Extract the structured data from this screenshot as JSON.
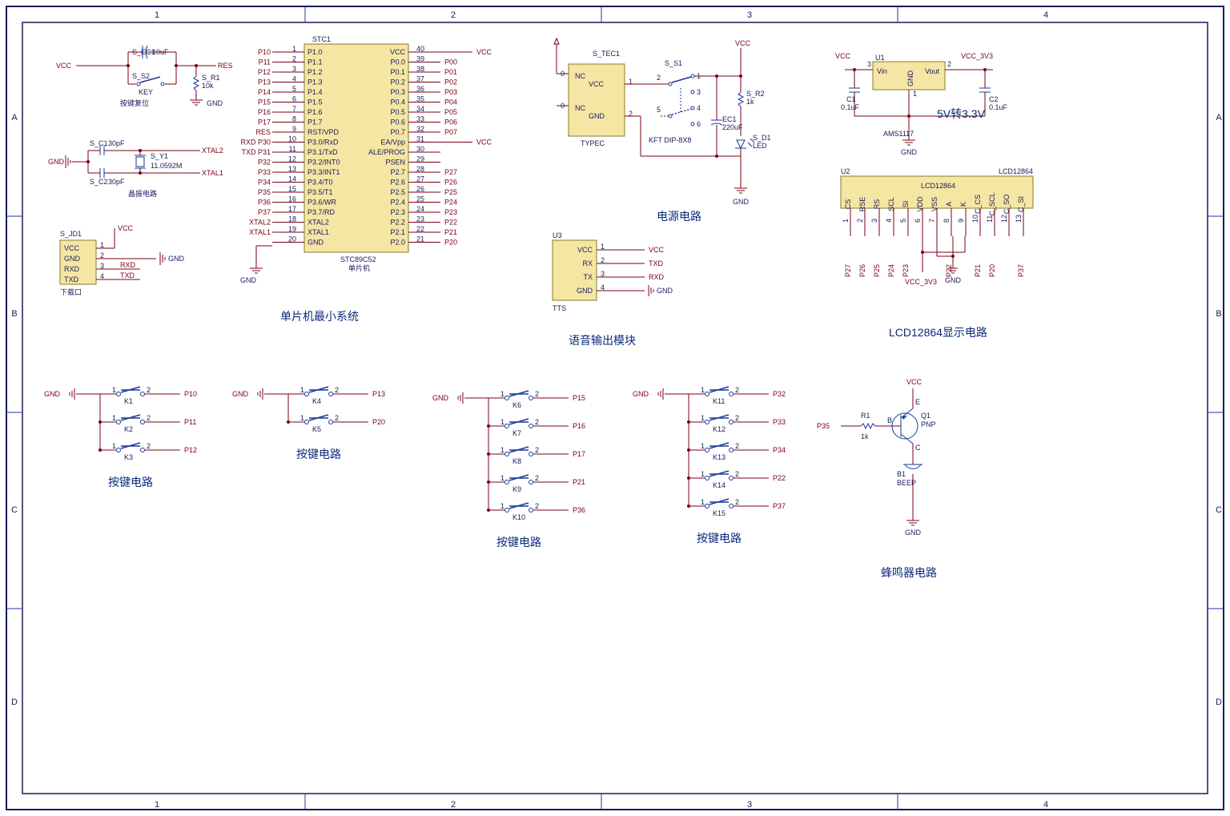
{
  "border": {
    "cols": [
      "1",
      "2",
      "3",
      "4"
    ],
    "rows": [
      "A",
      "B",
      "C",
      "D"
    ]
  },
  "reset": {
    "ref": "S_EC1",
    "cap": "10uF",
    "sw": "S_S2",
    "sw_label": "KEY",
    "r": "S_R1",
    "r_val": "10k",
    "vcc": "VCC",
    "res": "RES",
    "gnd": "GND",
    "title": "按键复位"
  },
  "osc": {
    "c1": "S_C1",
    "c1_val": "30pF",
    "c2": "S_C2",
    "c2_val": "30pF",
    "y": "S_Y1",
    "y_val": "11.0592M",
    "x1": "XTAL1",
    "x2": "XTAL2",
    "gnd": "GND",
    "title": "晶振电路"
  },
  "dl": {
    "ref": "S_JD1",
    "pins": [
      "VCC",
      "GND",
      "RXD",
      "TXD"
    ],
    "pins_num": [
      "1",
      "2",
      "3",
      "4"
    ],
    "vcc": "VCC",
    "gnd": "GND",
    "rxd": "RXD",
    "txd": "TXD",
    "title": "下载口"
  },
  "mcu": {
    "ref": "STC1",
    "part": "STC89C52",
    "title": "单片机",
    "sys_title": "单片机最小系统",
    "left_pins": [
      {
        "n": "1",
        "name": "P1.0",
        "net": "P10"
      },
      {
        "n": "2",
        "name": "P1.1",
        "net": "P11"
      },
      {
        "n": "3",
        "name": "P1.2",
        "net": "P12"
      },
      {
        "n": "4",
        "name": "P1.3",
        "net": "P13"
      },
      {
        "n": "5",
        "name": "P1.4",
        "net": "P14"
      },
      {
        "n": "6",
        "name": "P1.5",
        "net": "P15"
      },
      {
        "n": "7",
        "name": "P1.6",
        "net": "P16"
      },
      {
        "n": "8",
        "name": "P1.7",
        "net": "P17"
      },
      {
        "n": "9",
        "name": "RST/VPD",
        "net": "RES"
      },
      {
        "n": "10",
        "name": "P3.0/RxD",
        "net": "RXD P30"
      },
      {
        "n": "11",
        "name": "P3.1/TxD",
        "net": "TXD P31"
      },
      {
        "n": "12",
        "name": "P3.2/INT0",
        "net": "P32"
      },
      {
        "n": "13",
        "name": "P3.3/INT1",
        "net": "P33"
      },
      {
        "n": "14",
        "name": "P3.4/T0",
        "net": "P34"
      },
      {
        "n": "15",
        "name": "P3.5/T1",
        "net": "P35"
      },
      {
        "n": "16",
        "name": "P3.6/WR",
        "net": "P36"
      },
      {
        "n": "17",
        "name": "P3.7/RD",
        "net": "P37"
      },
      {
        "n": "18",
        "name": "XTAL2",
        "net": "XTAL2"
      },
      {
        "n": "19",
        "name": "XTAL1",
        "net": "XTAL1"
      },
      {
        "n": "20",
        "name": "GND",
        "net": ""
      }
    ],
    "right_pins": [
      {
        "n": "40",
        "name": "VCC",
        "net": "VCC"
      },
      {
        "n": "39",
        "name": "P0.0",
        "net": "P00"
      },
      {
        "n": "38",
        "name": "P0.1",
        "net": "P01"
      },
      {
        "n": "37",
        "name": "P0.2",
        "net": "P02"
      },
      {
        "n": "36",
        "name": "P0.3",
        "net": "P03"
      },
      {
        "n": "35",
        "name": "P0.4",
        "net": "P04"
      },
      {
        "n": "34",
        "name": "P0.5",
        "net": "P05"
      },
      {
        "n": "33",
        "name": "P0.6",
        "net": "P06"
      },
      {
        "n": "32",
        "name": "P0.7",
        "net": "P07"
      },
      {
        "n": "31",
        "name": "EA/Vpp",
        "net": "VCC"
      },
      {
        "n": "30",
        "name": "ALE/PROG",
        "net": ""
      },
      {
        "n": "29",
        "name": "PSEN",
        "net": ""
      },
      {
        "n": "28",
        "name": "P2.7",
        "net": "P27"
      },
      {
        "n": "27",
        "name": "P2.6",
        "net": "P26"
      },
      {
        "n": "26",
        "name": "P2.5",
        "net": "P25"
      },
      {
        "n": "25",
        "name": "P2.4",
        "net": "P24"
      },
      {
        "n": "24",
        "name": "P2.3",
        "net": "P23"
      },
      {
        "n": "23",
        "name": "P2.2",
        "net": "P22"
      },
      {
        "n": "22",
        "name": "P2.1",
        "net": "P21"
      },
      {
        "n": "21",
        "name": "P2.0",
        "net": "P20"
      }
    ],
    "gnd": "GND"
  },
  "power": {
    "title": "电源电路",
    "usb": "S_TEC1",
    "usb_part": "TYPEC",
    "usb_pins": [
      "NC",
      "VCC",
      "NC",
      "GND"
    ],
    "usb_num": [
      "0",
      "1",
      "0",
      "2"
    ],
    "sw": "S_S1",
    "dip": "KFT DIP-8X8",
    "r": "S_R2",
    "r_val": "1k",
    "cap": "EC1",
    "cap_val": "220uF",
    "led": "S_D1",
    "led_val": "LED",
    "vcc": "VCC",
    "gnd": "GND"
  },
  "tts": {
    "title": "语音输出模块",
    "ref": "U3",
    "part": "TTS",
    "pins": [
      "VCC",
      "RX",
      "TX",
      "GND"
    ],
    "pins_num": [
      "1",
      "2",
      "3",
      "4"
    ],
    "nets": [
      "VCC",
      "TXD",
      "RXD",
      "GND"
    ]
  },
  "reg": {
    "title": "5V转3.3V",
    "ref": "U1",
    "part": "AMS1117",
    "pin_in": "Vin",
    "pin_out": "Vout",
    "pin_gnd": "GND",
    "c1": "C1",
    "c1_val": "0.1uF",
    "c2": "C2",
    "c2_val": "0.1uF",
    "vcc": "VCC",
    "v33": "VCC_3V3",
    "gnd": "GND",
    "n1": "1",
    "n2": "2",
    "n3": "3"
  },
  "lcd": {
    "title": "LCD12864显示电路",
    "ref": "U2",
    "part": "LCD12864",
    "pins": [
      "CS",
      "RSE",
      "RS",
      "SCL",
      "SI",
      "VDD",
      "VSS",
      "A",
      "K",
      "C_CS",
      "C_SCL",
      "C_SO",
      "C_SI"
    ],
    "nums": [
      "1",
      "2",
      "3",
      "4",
      "5",
      "6",
      "7",
      "8",
      "9",
      "10",
      "11",
      "12",
      "13"
    ],
    "nets": [
      "P27",
      "P26",
      "P25",
      "P24",
      "P23",
      "",
      "",
      "P22",
      "",
      "P21",
      "P20",
      "",
      "P37"
    ],
    "vdd": "VCC_3V3",
    "gnd": "GND"
  },
  "keys1": {
    "title": "按键电路",
    "gnd": "GND",
    "rows": [
      {
        "k": "K1",
        "net": "P10"
      },
      {
        "k": "K2",
        "net": "P11"
      },
      {
        "k": "K3",
        "net": "P12"
      }
    ]
  },
  "keys2": {
    "title": "按键电路",
    "gnd": "GND",
    "rows": [
      {
        "k": "K4",
        "net": "P13"
      },
      {
        "k": "K5",
        "net": "P20"
      }
    ]
  },
  "keys3": {
    "title": "按键电路",
    "gnd": "GND",
    "rows": [
      {
        "k": "K6",
        "net": "P15"
      },
      {
        "k": "K7",
        "net": "P16"
      },
      {
        "k": "K8",
        "net": "P17"
      },
      {
        "k": "K9",
        "net": "P21"
      },
      {
        "k": "K10",
        "net": "P36"
      }
    ]
  },
  "keys4": {
    "title": "按键电路",
    "gnd": "GND",
    "rows": [
      {
        "k": "K11",
        "net": "P32"
      },
      {
        "k": "K12",
        "net": "P33"
      },
      {
        "k": "K13",
        "net": "P34"
      },
      {
        "k": "K14",
        "net": "P22"
      },
      {
        "k": "K15",
        "net": "P37"
      }
    ]
  },
  "buzz": {
    "title": "蜂鸣器电路",
    "net": "P35",
    "r": "R1",
    "r_val": "1k",
    "q": "Q1",
    "q_val": "PNP",
    "b": "B1",
    "b_val": "BEEP",
    "vcc": "VCC",
    "gnd": "GND",
    "E": "E",
    "B": "B",
    "C": "C"
  }
}
